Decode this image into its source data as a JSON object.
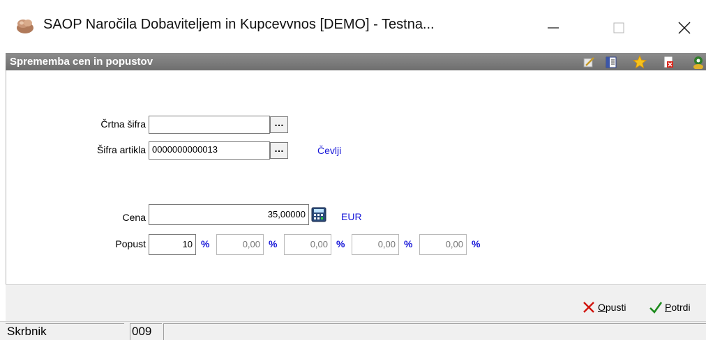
{
  "window": {
    "title": "SAOP   Naročila Dobaviteljem in Kupcevvnos [DEMO] - Testna...",
    "icon": "saop-app-icon"
  },
  "header": {
    "title": "Sprememba cen in popustov",
    "icons": [
      "edit-icon",
      "list-icon",
      "favorite-star-icon",
      "close-document-icon",
      "help-person-icon"
    ]
  },
  "form": {
    "barcode": {
      "label": "Črtna šifra",
      "value": ""
    },
    "article": {
      "label": "Šifra artikla",
      "value": "0000000000013",
      "name": "Čevlji"
    },
    "price": {
      "label": "Cena",
      "value": "35,00000",
      "currency": "EUR"
    },
    "discount": {
      "label": "Popust",
      "values": [
        "10",
        "0,00",
        "0,00",
        "0,00",
        "0,00"
      ],
      "unit": "%"
    }
  },
  "buttons": {
    "cancel": {
      "accel": "O",
      "rest": "pusti"
    },
    "confirm": {
      "accel": "P",
      "rest": "otrdi"
    }
  },
  "statusbar": {
    "user": "Skrbnik",
    "code": "009",
    "message": ""
  },
  "colors": {
    "header_bg": "#7b7b7b",
    "link_blue": "#1515d8",
    "cancel_red": "#d0140c",
    "confirm_green": "#1c8a1c"
  }
}
